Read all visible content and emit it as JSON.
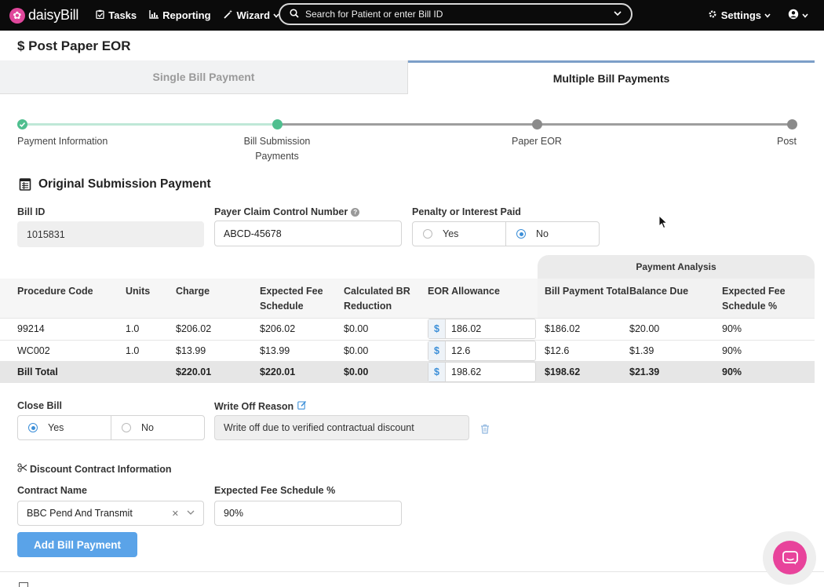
{
  "nav": {
    "logo_name": "daisyBill",
    "tasks": "Tasks",
    "reporting": "Reporting",
    "wizard": "Wizard",
    "search_placeholder": "Search for Patient or enter Bill ID",
    "settings": "Settings"
  },
  "page": {
    "title": "$ Post Paper EOR"
  },
  "tabs": [
    {
      "label": "Single Bill Payment",
      "active": false
    },
    {
      "label": "Multiple Bill Payments",
      "active": true
    }
  ],
  "stepper": {
    "steps": [
      {
        "label": "Payment Information",
        "state": "complete"
      },
      {
        "label": "Bill Submission Payments",
        "state": "current"
      },
      {
        "label": "Paper EOR",
        "state": "upcoming"
      },
      {
        "label": "Post",
        "state": "upcoming"
      }
    ]
  },
  "section": {
    "title": "Original Submission Payment",
    "bill_id_label": "Bill ID",
    "bill_id_value": "1015831",
    "pccn_label": "Payer Claim Control Number",
    "pccn_value": "ABCD-45678",
    "penalty_label": "Penalty or Interest Paid",
    "penalty_options": [
      "Yes",
      "No"
    ],
    "penalty_selected": "No"
  },
  "table": {
    "payment_analysis_label": "Payment Analysis",
    "headers": {
      "procedure_code": "Procedure Code",
      "units": "Units",
      "charge": "Charge",
      "expected_fee_schedule": "Expected Fee Schedule",
      "calculated_br_reduction": "Calculated BR Reduction",
      "eor_allowance": "EOR Allowance",
      "bill_payment_total": "Bill Payment Total",
      "balance_due": "Balance Due",
      "expected_fee_schedule_pct": "Expected Fee Schedule %"
    },
    "currency_symbol": "$",
    "rows": [
      {
        "code": "99214",
        "units": "1.0",
        "charge": "$206.02",
        "efs": "$206.02",
        "br": "$0.00",
        "eor": "186.02",
        "bpt": "$186.02",
        "bal": "$20.00",
        "pct": "90%"
      },
      {
        "code": "WC002",
        "units": "1.0",
        "charge": "$13.99",
        "efs": "$13.99",
        "br": "$0.00",
        "eor": "12.6",
        "bpt": "$12.6",
        "bal": "$1.39",
        "pct": "90%"
      }
    ],
    "total": {
      "label": "Bill Total",
      "charge": "$220.01",
      "efs": "$220.01",
      "br": "$0.00",
      "eor": "198.62",
      "bpt": "$198.62",
      "bal": "$21.39",
      "pct": "90%"
    }
  },
  "close_bill": {
    "label": "Close Bill",
    "options": [
      "Yes",
      "No"
    ],
    "selected": "Yes",
    "write_off_label": "Write Off Reason",
    "write_off_value": "Write off due to verified contractual discount"
  },
  "discount": {
    "title": "Discount Contract Information",
    "contract_label": "Contract Name",
    "contract_value": "BBC Pend And Transmit",
    "efs_pct_label": "Expected Fee Schedule %",
    "efs_pct_value": "90%"
  },
  "actions": {
    "add_bill_payment": "Add Bill Payment"
  },
  "colors": {
    "brand_pink": "#e8439b",
    "accent_blue": "#5aa3e8",
    "step_complete": "#4fbf8f",
    "step_upcoming": "#8a8a8a"
  }
}
